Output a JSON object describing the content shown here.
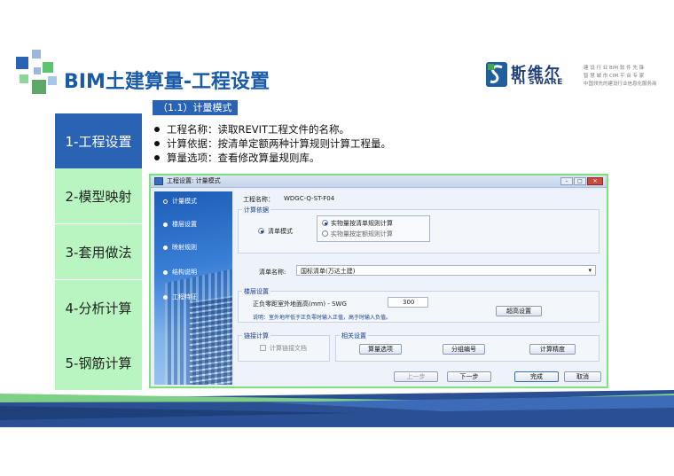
{
  "title": "BIM土建算量-工程设置",
  "logo": {
    "cn": "斯维尔",
    "en": "TH SWARE",
    "tag1": "建 设 行 业 BIM 软 件 先 锋",
    "tag2": "智 慧 城 市 CIM 平 台 专 家",
    "tag3": "中国领先的建设行业信息化服务商"
  },
  "sidebar": {
    "items": [
      {
        "label": "1-工程设置"
      },
      {
        "label": "2-模型映射"
      },
      {
        "label": "3-套用做法"
      },
      {
        "label": "4-分析计算"
      },
      {
        "label": "5-钢筋计算"
      }
    ]
  },
  "section_tag": "（1.1）计量模式",
  "bullets": [
    "工程名称：读取REVIT工程文件的名称。",
    "计算依据：按清单定额两种计算规则计算工程量。",
    "算量选项：查看修改算量规则库。"
  ],
  "dialog": {
    "title": "工程设置: 计量模式",
    "nav": [
      "计量模式",
      "楼层设置",
      "映射规则",
      "结构说明",
      "工程特征"
    ],
    "project_name_label": "工程名称：",
    "project_name_value": "WDGC-Q-ST-F04",
    "calc_basis": {
      "group_title": "计算依据",
      "mode_label": "清单模式",
      "option1": "实物量按清单规则计算",
      "option2": "实物量按定额规则计算"
    },
    "list_name_label": "清单名称:",
    "list_name_value": "国标清单(万达土建)",
    "floor": {
      "group_title": "楼层设置",
      "elev_label": "正负零距室外地面高(mm) - SWG",
      "elev_value": "300",
      "note": "说明：室外地坪低于正负零时输入正值，高于时输入负值。",
      "advanced_button": "超高设置"
    },
    "link": {
      "group_title": "链接计算",
      "checkbox_label": "计算链接文档"
    },
    "related": {
      "group_title": "相关设置",
      "buttons": [
        "算量选项",
        "分组编号",
        "计算精度"
      ]
    },
    "footer_buttons": [
      "上一步",
      "下一步",
      "完成",
      "取消"
    ]
  }
}
